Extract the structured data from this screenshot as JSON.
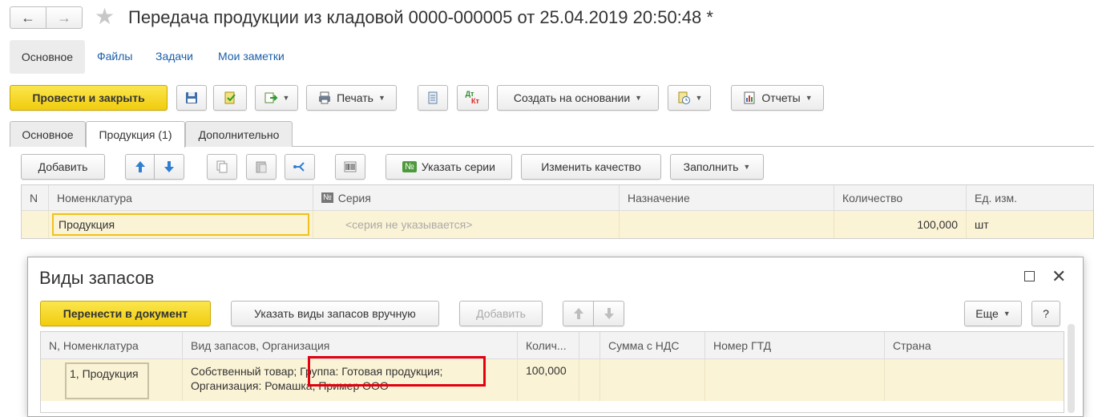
{
  "window": {
    "back_glyph": "←",
    "forward_glyph": "→",
    "star_glyph": "★",
    "title": "Передача продукции из кладовой 0000-000005 от 25.04.2019 20:50:48 *"
  },
  "sections": {
    "active": "Основное",
    "links": [
      "Файлы",
      "Задачи",
      "Мои заметки"
    ]
  },
  "toolbar": {
    "post_close": "Провести и закрыть",
    "print": "Печать",
    "dt_kt_top": "Дт",
    "dt_kt_bottom": "Кт",
    "create_based": "Создать на основании",
    "reports": "Отчеты"
  },
  "tabs": [
    "Основное",
    "Продукция (1)",
    "Дополнительно"
  ],
  "products_toolbar": {
    "add": "Добавить",
    "series_badge": "№",
    "specify_series": "Указать серии",
    "change_quality": "Изменить качество",
    "fill": "Заполнить"
  },
  "products_table": {
    "columns": [
      "N",
      "Номенклатура",
      "№",
      "Серия",
      "Назначение",
      "Количество",
      "Ед. изм."
    ],
    "rows": [
      {
        "n": "",
        "nomenclature": "Продукция",
        "series": "<серия не указывается>",
        "purpose": "",
        "quantity": "100,000",
        "unit": "шт"
      }
    ]
  },
  "dialog": {
    "title": "Виды запасов",
    "close_glyph": "✕",
    "transfer": "Перенести в документ",
    "manual": "Указать виды запасов вручную",
    "add": "Добавить",
    "more": "Еще",
    "help": "?",
    "columns": [
      "N, Номенклатура",
      "Вид запасов, Организация",
      "Колич...",
      "Сумма с НДС",
      "Номер ГТД",
      "Страна"
    ],
    "rows": [
      {
        "n_nomenclature": "1, Продукция",
        "stock_line1": "Собственный товар; Группа: Готовая продукция;",
        "stock_line2": "Организация: Ромашка, Пример ООО",
        "quantity": "100,000",
        "sum_vat": "",
        "gtd": "",
        "country": ""
      }
    ]
  },
  "colors": {
    "accent_yellow": "#f5d51f",
    "link_blue": "#1b5faa",
    "row_highlight": "#fbf3d5",
    "highlight_border": "#e3000f"
  }
}
